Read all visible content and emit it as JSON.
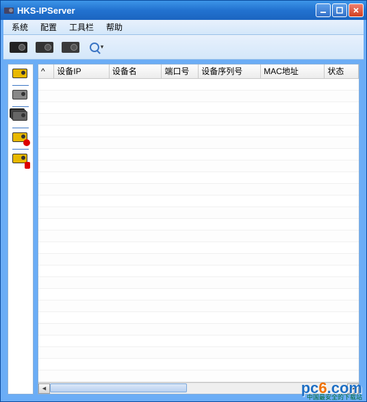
{
  "window": {
    "title": "HKS-IPServer"
  },
  "menu": {
    "system": "系统",
    "config": "配置",
    "toolbar": "工具栏",
    "help": "帮助"
  },
  "table": {
    "columns": {
      "sort": "^",
      "ip": "设备IP",
      "name": "设备名",
      "port": "端口号",
      "serial": "设备序列号",
      "mac": "MAC地址",
      "status": "状态"
    },
    "rows": []
  },
  "watermark": {
    "brand_prefix": "pc",
    "brand_six": "6",
    "brand_suffix": ".com",
    "tagline": "中国最安全的下载站"
  }
}
